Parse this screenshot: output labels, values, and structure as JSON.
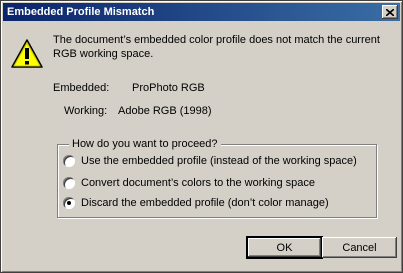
{
  "window": {
    "title": "Embedded Profile Mismatch",
    "close_icon": "close-icon"
  },
  "message": {
    "icon": "warning-icon",
    "text": "The document’s embedded color profile does not match the current RGB working space."
  },
  "profiles": {
    "embedded_label": "Embedded:",
    "embedded_value": "ProPhoto RGB",
    "working_label": "Working:",
    "working_value": "Adobe RGB (1998)"
  },
  "options": {
    "legend": "How do you want to proceed?",
    "items": [
      {
        "label": "Use the embedded profile (instead of the working space)",
        "selected": false
      },
      {
        "label": "Convert document’s colors to the working space",
        "selected": false
      },
      {
        "label": "Discard the embedded profile (don’t color manage)",
        "selected": true
      }
    ]
  },
  "buttons": {
    "ok": "OK",
    "cancel": "Cancel"
  },
  "colors": {
    "titlebar_start": "#0a246a",
    "titlebar_end": "#3a6ea5",
    "dialog_bg": "#d4d0c8",
    "warning_yellow": "#ffff00"
  }
}
